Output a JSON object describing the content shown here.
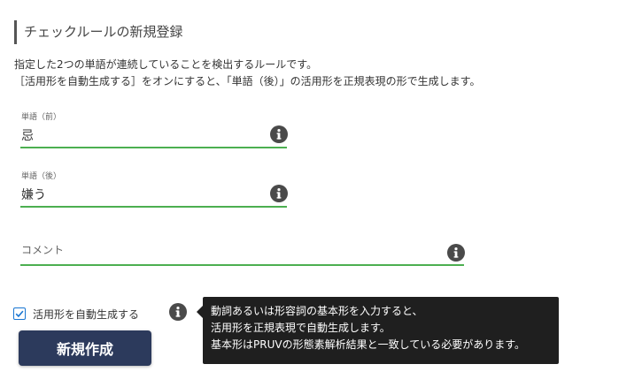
{
  "page": {
    "title": "チェックルールの新規登録",
    "description": [
      "指定した2つの単語が連続していることを検出するルールです。",
      "［活用形を自動生成する］をオンにすると、「単語（後）」の活用形を正規表現の形で生成します。"
    ]
  },
  "form": {
    "word_before": {
      "label": "単語（前）",
      "value": "忌"
    },
    "word_after": {
      "label": "単語（後）",
      "value": "嫌う"
    },
    "comment": {
      "placeholder": "コメント",
      "value": ""
    },
    "auto_conjugate": {
      "label": "活用形を自動生成する",
      "checked": true
    },
    "submit_label": "新規作成"
  },
  "tooltip": {
    "lines": [
      "動詞あるいは形容詞の基本形を入力すると、",
      "活用形を正規表現で自動生成します。",
      "基本形はPRUVの形態素解析結果と一致している必要があります。"
    ]
  },
  "colors": {
    "accent_green": "#4caf50",
    "button_bg": "#2c3a5c",
    "icon_gray": "#4a4a4a",
    "tooltip_bg": "#1f1f1f",
    "checkbox_blue": "#1976d2"
  },
  "icons": {
    "info": "info-icon",
    "check": "check-icon"
  }
}
